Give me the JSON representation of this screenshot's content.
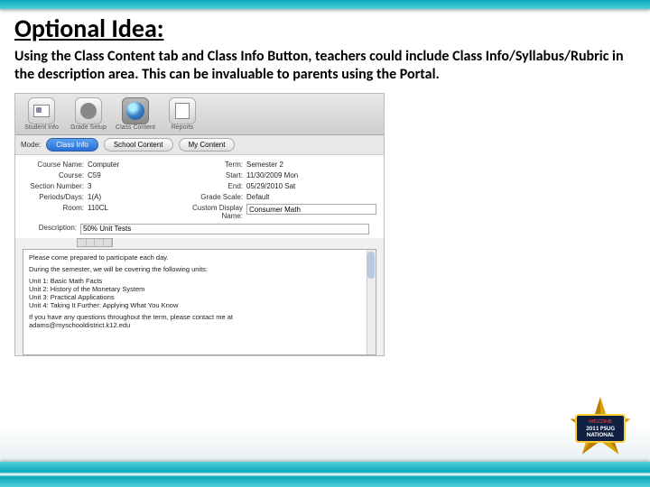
{
  "title": "Optional Idea:",
  "subtext": "Using the Class Content tab and Class Info Button, teachers could include Class Info/Syllabus/Rubric in the description area. This can be invaluable to parents using the Portal.",
  "toolbar": {
    "student_info": "Student Info",
    "grade_setup": "Grade Setup",
    "class_content": "Class Content",
    "reports": "Reports"
  },
  "mode": {
    "label": "Mode:",
    "class_info": "Class Info",
    "school_content": "School Content",
    "my_content": "My Content"
  },
  "fields": {
    "course_name_l": "Course Name:",
    "course_name_v": "Computer",
    "term_l": "Term:",
    "term_v": "Semester 2",
    "course_l": "Course:",
    "course_v": "C59",
    "start_l": "Start:",
    "start_v": "11/30/2009 Mon",
    "section_l": "Section Number:",
    "section_v": "3",
    "end_l": "End:",
    "end_v": "05/29/2010 Sat",
    "periods_l": "Periods/Days:",
    "periods_v": "1(A)",
    "gradescale_l": "Grade Scale:",
    "gradescale_v": "Default",
    "room_l": "Room:",
    "room_v": "110CL",
    "customname_l": "Custom Display Name:",
    "customname_v": "Consumer Math"
  },
  "desc": {
    "label": "Description:",
    "line1": "50% Unit Tests"
  },
  "editor": {
    "p1": "Please come prepared to participate each day.",
    "p2": "During the semester, we will be covering the following units:",
    "u1": "Unit 1: Basic Math Facts",
    "u2": "Unit 2: History of the Monetary System",
    "u3": "Unit 3: Practical Applications",
    "u4": "Unit 4: Taking It Further: Applying What You Know",
    "p3a": "If you have any questions throughout the term, please contact me at",
    "p3b": "adams@myschooldistrict.k12.edu"
  },
  "badge": {
    "line1": "WELCOME",
    "line2": "2011 PSUG NATIONAL"
  }
}
